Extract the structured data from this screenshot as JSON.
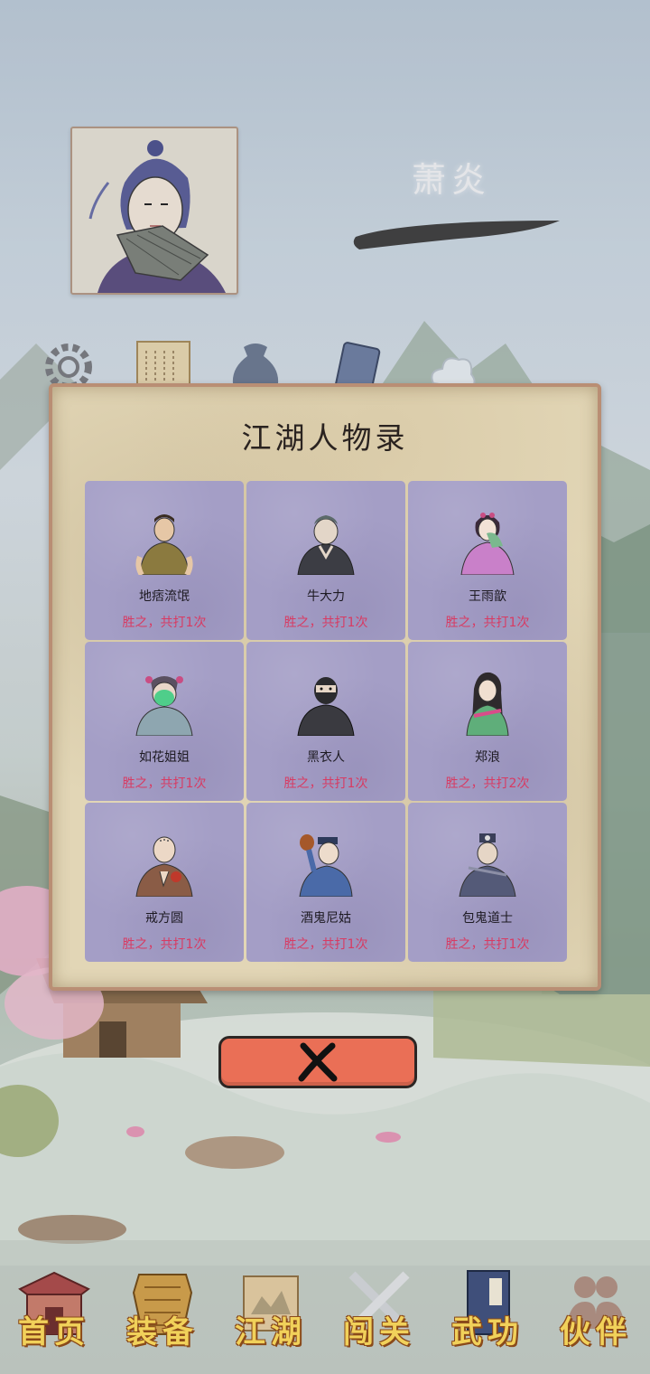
{
  "player": {
    "name": "萧炎"
  },
  "dialog": {
    "title": "江湖人物录",
    "characters": [
      {
        "name": "地痞流氓",
        "record": "胜之，共打1次"
      },
      {
        "name": "牛大力",
        "record": "胜之，共打1次"
      },
      {
        "name": "王雨歆",
        "record": "胜之，共打1次"
      },
      {
        "name": "如花姐姐",
        "record": "胜之，共打1次"
      },
      {
        "name": "黑衣人",
        "record": "胜之，共打1次"
      },
      {
        "name": "郑浪",
        "record": "胜之，共打2次"
      },
      {
        "name": "戒方圆",
        "record": "胜之，共打1次"
      },
      {
        "name": "酒鬼尼姑",
        "record": "胜之，共打1次"
      },
      {
        "name": "包鬼道士",
        "record": "胜之，共打1次"
      }
    ],
    "close_icon": "close-x-icon"
  },
  "nav": {
    "items": [
      {
        "label": "首页",
        "icon": "house-icon"
      },
      {
        "label": "装备",
        "icon": "armor-icon"
      },
      {
        "label": "江湖",
        "icon": "scroll-map-icon"
      },
      {
        "label": "闯关",
        "icon": "crossed-swords-icon"
      },
      {
        "label": "武功",
        "icon": "book-icon"
      },
      {
        "label": "伙伴",
        "icon": "companions-icon"
      }
    ]
  },
  "colors": {
    "card_bg": "#a49ec6",
    "record_text": "#d83a62",
    "nav_label": "#f1d15a",
    "close_button": "#ea6f56",
    "dialog_border": "#b98e74"
  }
}
